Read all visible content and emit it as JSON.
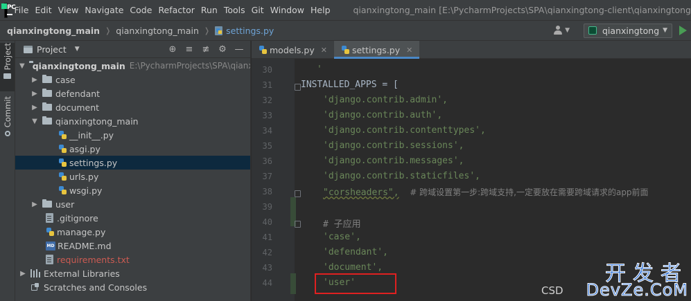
{
  "menubar": {
    "items": [
      "File",
      "Edit",
      "View",
      "Navigate",
      "Code",
      "Refactor",
      "Run",
      "Tools",
      "Git",
      "Window",
      "Help"
    ],
    "window_title": "qianxingtong_main [E:\\PycharmProjects\\SPA\\qianxingtong-client\\qianxingtong"
  },
  "navbar": {
    "project": "qianxingtong_main",
    "folder": "qianxingtong_main",
    "file": "settings.py",
    "run_config": "qianxingtong"
  },
  "toolstrip": {
    "project_tab": "Project",
    "commit_tab": "Commit"
  },
  "project_panel": {
    "title": "Project",
    "root_name": "qianxingtong_main",
    "root_path": "E:\\PycharmProjects\\SPA\\qianxin",
    "folders": {
      "case": "case",
      "defendant": "defendant",
      "document": "document",
      "qianxingtong_main": "qianxingtong_main",
      "user": "user"
    },
    "files": {
      "init": "__init__.py",
      "asgi": "asgi.py",
      "settings": "settings.py",
      "urls": "urls.py",
      "wsgi": "wsgi.py",
      "gitignore": ".gitignore",
      "manage": "manage.py",
      "readme": "README.md",
      "requirements": "requirements.txt"
    },
    "external_libraries": "External Libraries",
    "scratches": "Scratches and Consoles"
  },
  "editor": {
    "tabs": [
      "models.py",
      "settings.py"
    ],
    "active_tab": "settings.py",
    "line_numbers": [
      "30",
      "31",
      "32",
      "33",
      "34",
      "35",
      "36",
      "37",
      "38",
      "39",
      "40",
      "41",
      "42",
      "43",
      "44"
    ],
    "lines": {
      "l30": "'",
      "l31": "INSTALLED_APPS = [",
      "l32": "'django.contrib.admin',",
      "l33": "'django.contrib.auth',",
      "l34": "'django.contrib.contenttypes',",
      "l35": "'django.contrib.sessions',",
      "l36": "'django.contrib.messages',",
      "l37": "'django.contrib.staticfiles',",
      "l38_str": "\"corsheaders\",",
      "l38_cmt": "# 跨域设置第一步:跨域支持,一定要放在需要跨域请求的app前面",
      "l40": "# 子应用",
      "l41": "'case',",
      "l42": "'defendant',",
      "l43": "'document',",
      "l44": "'user'"
    }
  },
  "watermark": {
    "cn": "开发者",
    "en": "DevZe.CoM",
    "prefix": "CSD"
  },
  "colors": {
    "string": "#6a8759",
    "comment": "#808080",
    "highlight_box": "#e02020",
    "selection": "#0d293e",
    "watermark": "#3d7bd9"
  }
}
